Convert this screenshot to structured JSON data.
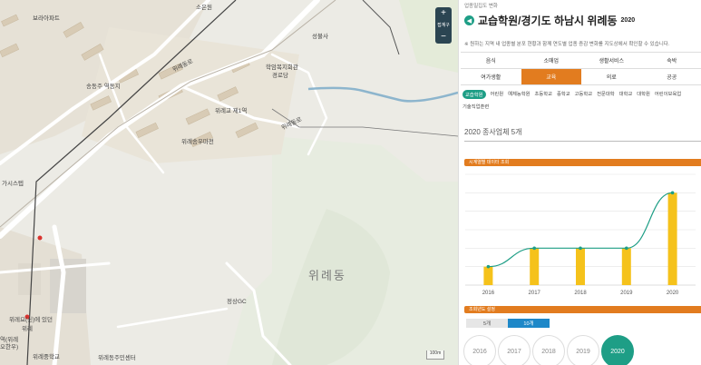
{
  "map": {
    "labels": {
      "bora_apt": "보라아파트",
      "soeungwon": "소은원",
      "seongbulsa": "성불사",
      "hakdong": "학암복지회관",
      "gyeongrodang": "경로당",
      "songdongju": "송동주 역동지",
      "wirye_cheil": "위례교 제1역",
      "wirye_road": "위례동로",
      "wirye_songwon": "위례송우마전",
      "wirye_ro_2": "위례동로",
      "gwangju_cheon": "가시스텝",
      "wirye_apt": "위레요(신)에 있던",
      "wirye_sub": "위례",
      "wirye_bottom": "위례동주민센터",
      "wirye_school": "위례중학교",
      "wirye_yeok": "역(위례",
      "wirye_yeok2": "오한우)",
      "jisan": "정상GC",
      "district": "위례동"
    },
    "zoom": {
      "plus": "+",
      "minus": "−",
      "label": "접계구"
    },
    "scale": "100m"
  },
  "panel": {
    "breadcrumb": "업종밀집도 변화",
    "title": "교습학원/경기도 하남시 위례동",
    "title_year": "2020",
    "note": "※ 원하는 지역 내 업종별 분포 현황과 함께 연도별 업종 증감 변화를 지도상에서 확인할 수 있습니다.",
    "categories_row1": [
      "음식",
      "소매업",
      "생활서비스",
      "숙박"
    ],
    "categories_row2": [
      "여가생활",
      "교육",
      "의료",
      "공공"
    ],
    "active_category": "교육",
    "subcategories": [
      "교습학원",
      "어린원",
      "예체능학원",
      "초등학교",
      "중학교",
      "고등학교",
      "전문대학",
      "대학교",
      "대학원",
      "어린이보육업",
      "기술직업훈련"
    ],
    "active_sub": "교습학원",
    "count_text": "2020 종사업체 5개",
    "section_trend": "시계열별 데이터 조회",
    "section_year": "조회년도 설정",
    "period_tabs": [
      "5개",
      "10개"
    ],
    "active_tab": "10개",
    "years": [
      "2016",
      "2017",
      "2018",
      "2019",
      "2020"
    ],
    "active_year": "2020"
  },
  "chart_data": {
    "type": "bar",
    "categories": [
      "2016",
      "2017",
      "2018",
      "2019",
      "2020"
    ],
    "values": [
      1,
      2,
      2,
      2,
      5
    ],
    "ylim": [
      0,
      6
    ],
    "grid": true,
    "bar_color": "#f5c21b",
    "line_color": "#1e9e86"
  },
  "colors": {
    "accent": "#e27c1f",
    "teal": "#1e9e86",
    "navy": "#2b4552",
    "blue": "#1e88c8"
  }
}
